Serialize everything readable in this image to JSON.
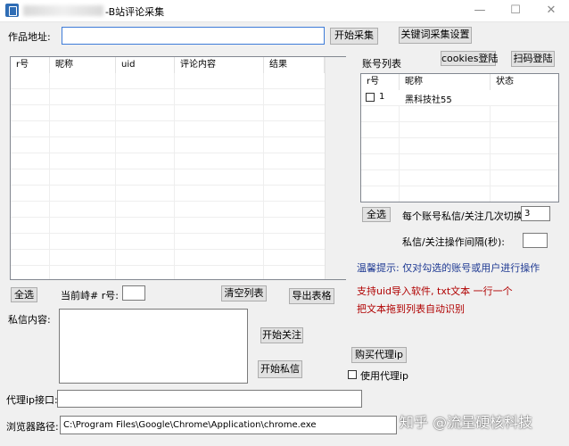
{
  "window": {
    "title": "-B站评论采集",
    "minimize": "—",
    "maximize": "☐",
    "close": "✕"
  },
  "top": {
    "url_label": "作品地址:",
    "url_value": "",
    "start_collect": "开始采集",
    "keyword_settings": "关键词采集设置"
  },
  "comments_table": {
    "columns": [
      "r号",
      "昵称",
      "uid",
      "评论内容",
      "结果"
    ],
    "select_all": "全选",
    "current_label": "当前峙# r号:",
    "current_value": "",
    "clear_list": "清空列表",
    "export": "导出表格"
  },
  "accounts": {
    "title": "账号列表",
    "cookies_login": "cookies登陆",
    "qr_login": "扫码登陆",
    "columns": [
      "r号",
      "昵称",
      "状态"
    ],
    "rows": [
      {
        "num": "1",
        "name": "黑科技社55",
        "status": ""
      }
    ],
    "select_all": "全选",
    "switch_label": "每个账号私信/关注几次切换:",
    "switch_value": "3",
    "interval_label": "私信/关注操作间隔(秒):",
    "interval_value": ""
  },
  "tips": {
    "notice": "温馨提示: 仅对勾选的账号或用户进行操作",
    "import_line1": "支持uid导入软件, txt文本 一行一个",
    "import_line2": "把文本拖到列表自动识别"
  },
  "message": {
    "label": "私信内容:",
    "value": "",
    "start_follow": "开始关注",
    "start_message": "开始私信",
    "buy_proxy": "购买代理ip",
    "use_proxy": "使用代理ip"
  },
  "bottom": {
    "proxy_label": "代理ip接口:",
    "proxy_value": "",
    "browser_label": "浏览器路径:",
    "browser_value": "C:\\Program Files\\Google\\Chrome\\Application\\chrome.exe"
  },
  "watermark": "知乎 @流量硬核科技",
  "colors": {
    "tip_blue": "#1f3a93",
    "tip_red": "#b00000",
    "focus_border": "#3d7bd8"
  }
}
